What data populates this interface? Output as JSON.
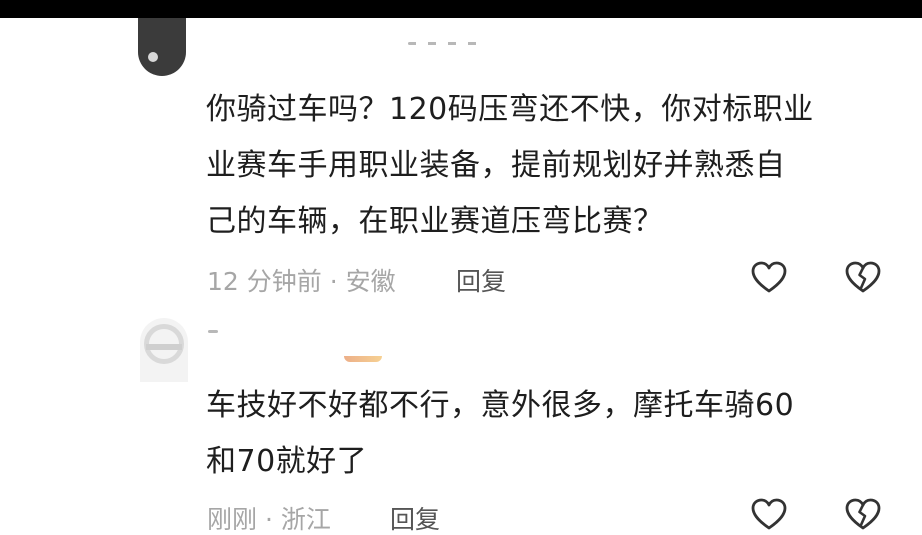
{
  "comments": [
    {
      "text_lines": [
        "你骑过车吗？120码压弯还不快，你对标职业",
        "业赛车手用职业装备，提前规划好并熟悉自",
        "己的车辆，在职业赛道压弯比赛？"
      ],
      "time": "12 分钟前",
      "separator": "·",
      "location": "安徽",
      "reply_label": "回复",
      "like_icon": "heart-outline-icon",
      "dislike_icon": "broken-heart-icon"
    },
    {
      "text_lines": [
        "车技好不好都不行，意外很多，摩托车骑60",
        "和70就好了"
      ],
      "time": "刚刚",
      "separator": "·",
      "location": "浙江",
      "reply_label": "回复",
      "like_icon": "heart-outline-icon",
      "dislike_icon": "broken-heart-icon"
    }
  ],
  "colors": {
    "text": "#1e1e1e",
    "meta": "#a6a6a6",
    "reply": "#555555",
    "icon": "#333333",
    "top_bar": "#000000"
  }
}
